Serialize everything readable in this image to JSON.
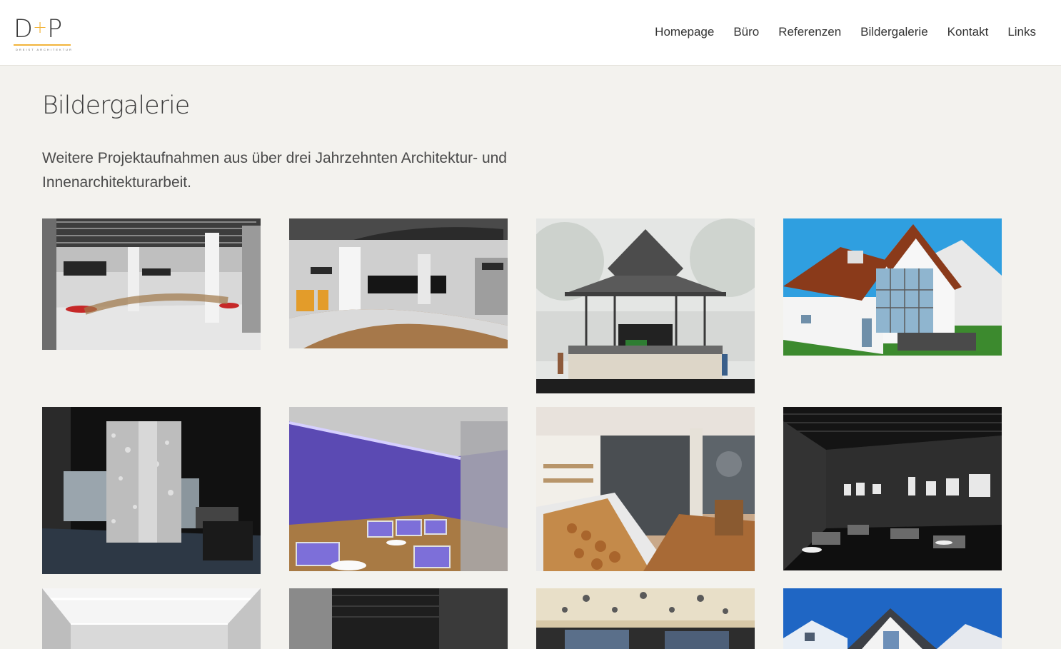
{
  "brand": {
    "logo_text_left": "D",
    "logo_plus": "+",
    "logo_text_right": "P",
    "tagline": "DREIST ARCHITEKTUR",
    "accent_color": "#f2b43b"
  },
  "nav": {
    "items": [
      {
        "label": "Homepage"
      },
      {
        "label": "Büro"
      },
      {
        "label": "Referenzen"
      },
      {
        "label": "Bildergalerie"
      },
      {
        "label": "Kontakt"
      },
      {
        "label": "Links"
      }
    ]
  },
  "page": {
    "title": "Bildergalerie",
    "intro": "Weitere Projektaufnahmen aus über drei Jahrzehnten Architektur- und Innenarchitekturarbeit."
  },
  "gallery": {
    "items": [
      {
        "subject": "interior-hall"
      },
      {
        "subject": "interior-hall-night"
      },
      {
        "subject": "pavilion"
      },
      {
        "subject": "house-render"
      },
      {
        "subject": "dark-room-column"
      },
      {
        "subject": "purple-lounge"
      },
      {
        "subject": "bakery-cafe"
      },
      {
        "subject": "dark-gallery"
      },
      {
        "subject": "bright-corridor"
      },
      {
        "subject": "dark-interior"
      },
      {
        "subject": "restaurant-ceiling"
      },
      {
        "subject": "house-photo"
      }
    ]
  }
}
